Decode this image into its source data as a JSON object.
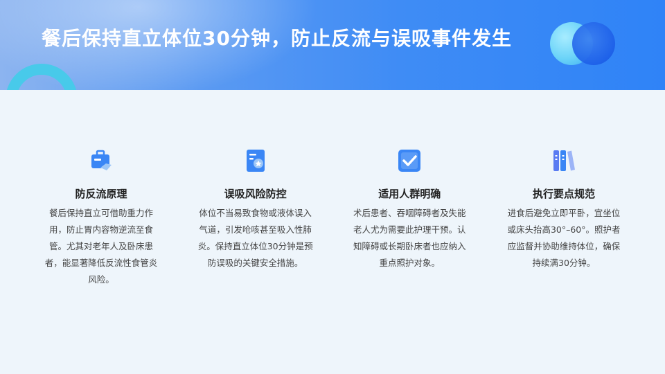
{
  "header": {
    "title": "餐后保持直立体位30分钟，防止反流与误吸事件发生"
  },
  "cards": [
    {
      "icon": "briefcase-icon",
      "title": "防反流原理",
      "body": "餐后保持直立可借助重力作用，防止胃内容物逆流至食管。尤其对老年人及卧床患者，能显著降低反流性食管炎风险。"
    },
    {
      "icon": "document-shield-icon",
      "title": "误吸风险防控",
      "body": "体位不当易致食物或液体误入气道，引发呛咳甚至吸入性肺炎。保持直立体位30分钟是预防误吸的关键安全措施。"
    },
    {
      "icon": "checkbox-icon",
      "title": "适用人群明确",
      "body": "术后患者、吞咽障碍者及失能老人尤为需要此护理干预。认知障碍或长期卧床者也应纳入重点照护对象。"
    },
    {
      "icon": "books-icon",
      "title": "执行要点规范",
      "body": "进食后避免立即平卧，宜坐位或床头抬高30°–60°。照护者应监督并协助维持体位，确保持续满30分钟。"
    }
  ],
  "colors": {
    "header_start": "#8cb4f0",
    "header_end": "#2f83f7",
    "background": "#eef5fb",
    "icon_blue": "#3a86f5",
    "icon_light": "#9cc6f7"
  }
}
